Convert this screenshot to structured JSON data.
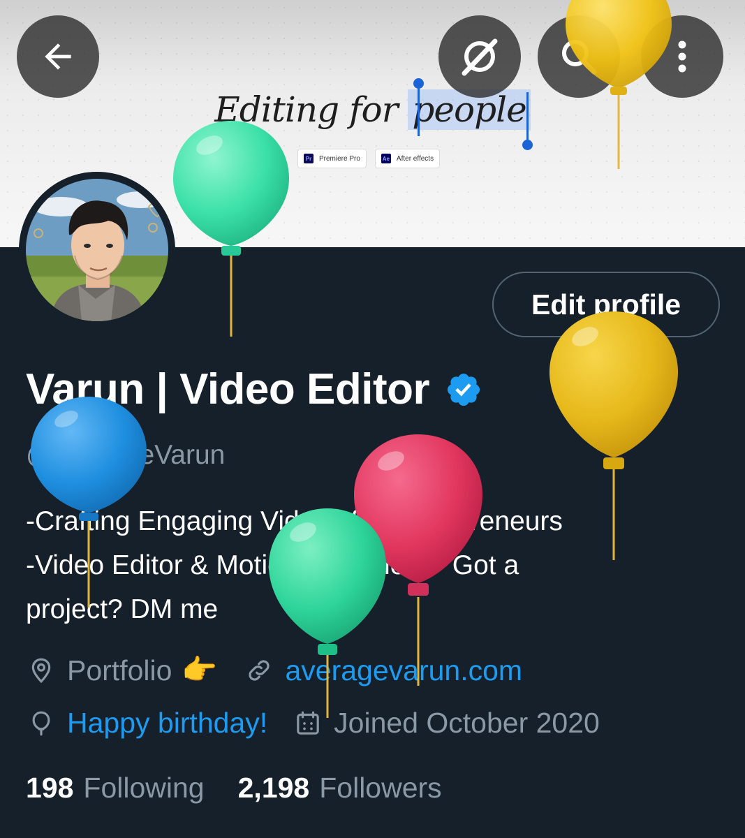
{
  "banner": {
    "title_prefix": "Editing for ",
    "title_highlight": "people",
    "chips": [
      {
        "badge": "Pr",
        "label": "Premiere Pro"
      },
      {
        "badge": "Ae",
        "label": "After effects"
      }
    ]
  },
  "toolbar": {
    "back_icon": "arrow-left-icon",
    "grok_icon": "grok-icon",
    "search_icon": "search-icon",
    "more_icon": "more-vertical-icon"
  },
  "profile": {
    "edit_label": "Edit profile",
    "name": "Varun | Video Editor",
    "verified_icon": "verified-badge-icon",
    "handle": "@AverageVarun",
    "bio_lines": [
      "-Crafting Engaging Videos for Entrepreneurs",
      "-Video Editor & Motion Designer ✦ Got a",
      "project? DM me"
    ],
    "location": "Portfolio",
    "location_emoji": "👉",
    "website": "averagevarun.com",
    "birthday": "Happy birthday!",
    "joined": "Joined October 2020",
    "following_count": "198",
    "following_label": "Following",
    "followers_count": "2,198",
    "followers_label": "Followers"
  },
  "colors": {
    "background": "#15202b",
    "accent": "#1d9bf0",
    "muted": "#8b98a5",
    "verified": "#1d9bf0"
  },
  "overlays": {
    "balloon_colors": [
      "#3be0a8",
      "#f2c314",
      "#1f8fe0",
      "#e2375f",
      "#2ed59a",
      "#e6b81a"
    ]
  }
}
